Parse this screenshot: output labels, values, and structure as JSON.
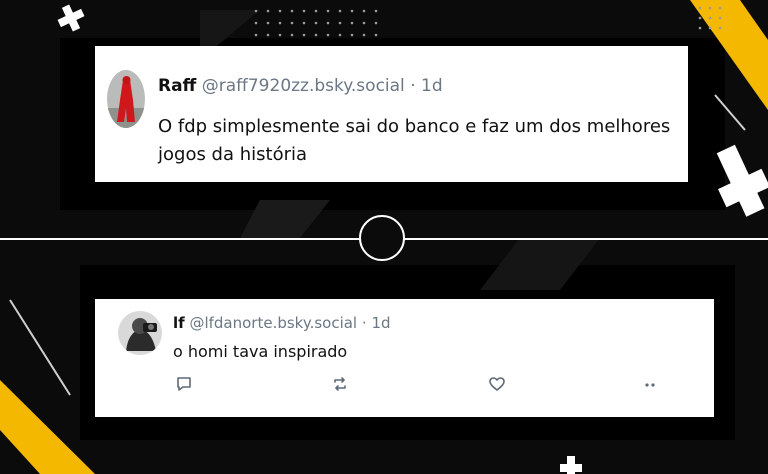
{
  "colors": {
    "accent_yellow": "#f5b800",
    "card_bg": "#ffffff",
    "handle_gray": "#6b7784",
    "divider": "#ffffff"
  },
  "posts": [
    {
      "author": "Raff",
      "handle": "@raff7920zz.bsky.social",
      "separator": "·",
      "time": "1d",
      "text": "O fdp simplesmente sai do banco e faz um dos melhores jogos da história"
    },
    {
      "author": "lf",
      "handle": "@lfdanorte.bsky.social",
      "separator": "·",
      "time": "1d",
      "text": "o homi tava inspirado",
      "actions": [
        "reply-icon",
        "repost-icon",
        "like-icon",
        "more-icon"
      ]
    }
  ]
}
